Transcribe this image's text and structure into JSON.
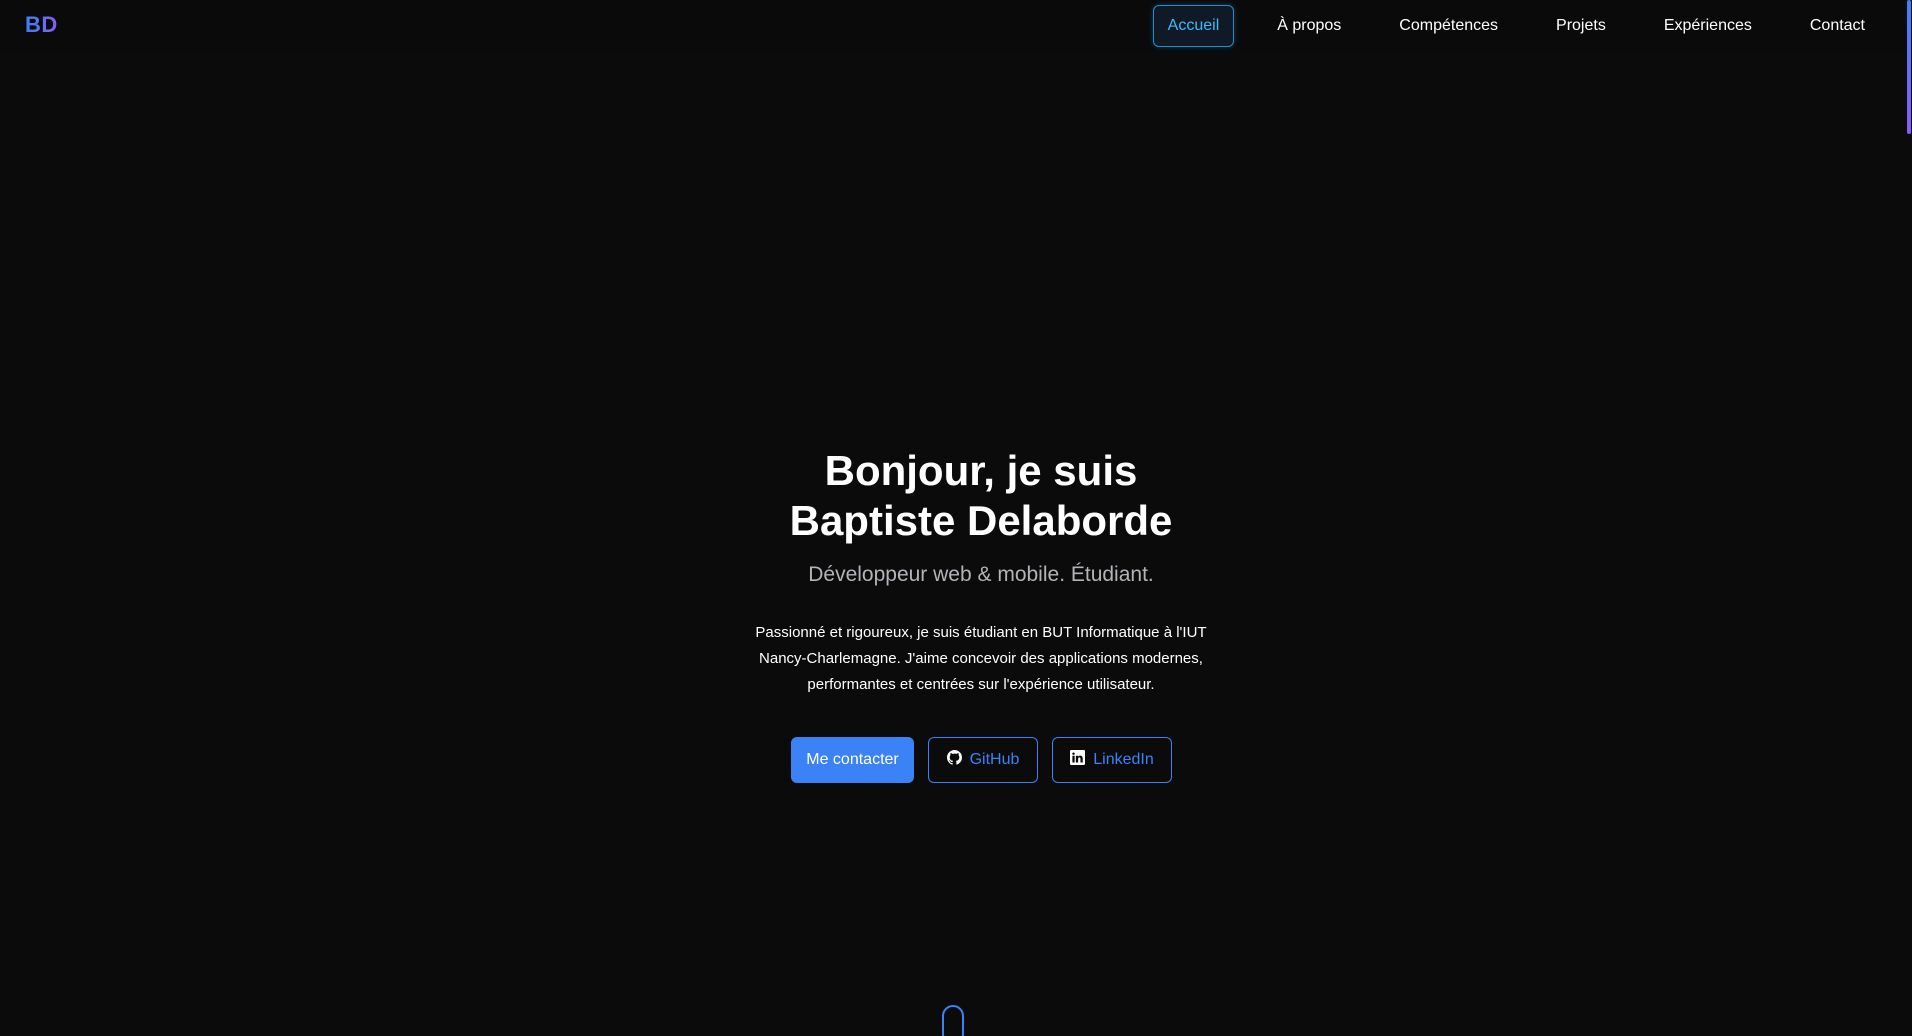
{
  "logo": "BD",
  "nav": {
    "items": [
      {
        "label": "Accueil",
        "active": true
      },
      {
        "label": "À propos",
        "active": false
      },
      {
        "label": "Compétences",
        "active": false
      },
      {
        "label": "Projets",
        "active": false
      },
      {
        "label": "Expériences",
        "active": false
      },
      {
        "label": "Contact",
        "active": false
      }
    ]
  },
  "hero": {
    "title_line1": "Bonjour, je suis",
    "title_line2": "Baptiste Delaborde",
    "subtitle": "Développeur web & mobile. Étudiant.",
    "description": "Passionné et rigoureux, je suis étudiant en BUT Informatique à l'IUT Nancy-Charlemagne. J'aime concevoir des applications modernes, performantes et centrées sur l'expérience utilisateur.",
    "buttons": {
      "contact": "Me contacter",
      "github": "GitHub",
      "linkedin": "LinkedIn"
    }
  },
  "icons": {
    "github": "github-icon",
    "linkedin": "linkedin-icon",
    "scroll": "scroll-mouse-icon"
  },
  "colors": {
    "background": "#0b0b0c",
    "accent": "#3b82f6",
    "accent_secondary": "#8b5cf6",
    "active_nav": "#38bdf8",
    "subtitle": "#b3b3b8"
  }
}
